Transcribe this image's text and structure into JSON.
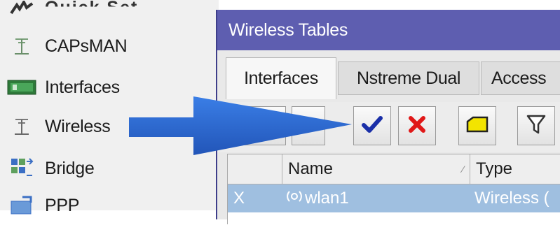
{
  "menu": {
    "items": [
      {
        "label": "Quick Set",
        "icon": "quickset-icon"
      },
      {
        "label": "CAPsMAN",
        "icon": "antenna-icon"
      },
      {
        "label": "Interfaces",
        "icon": "interfaces-icon"
      },
      {
        "label": "Wireless",
        "icon": "antenna-icon"
      },
      {
        "label": "Bridge",
        "icon": "bridge-icon"
      },
      {
        "label": "PPP",
        "icon": "ppp-icon"
      }
    ]
  },
  "window": {
    "title": "Wireless Tables",
    "tabs": [
      {
        "label": "Interfaces",
        "active": true
      },
      {
        "label": "Nstreme Dual",
        "active": false
      },
      {
        "label": "Access",
        "active": false
      }
    ],
    "toolbar": {
      "buttons": [
        {
          "icon": "add-icon"
        },
        {
          "icon": "remove-icon"
        },
        {
          "icon": "enable-check-icon",
          "color": "#1a2fa8"
        },
        {
          "icon": "disable-x-icon",
          "color": "#e01818"
        },
        {
          "icon": "comment-icon",
          "color": "#f3e400"
        },
        {
          "icon": "filter-icon"
        }
      ]
    },
    "table": {
      "columns": [
        "",
        "Name",
        "Type"
      ],
      "rows": [
        {
          "flag": "X",
          "name": "wlan1",
          "type": "Wireless ("
        }
      ]
    }
  },
  "colors": {
    "title_bar": "#5e5eb0",
    "arrow": "#2f6fd6",
    "selected_row": "#9fbfe0"
  }
}
